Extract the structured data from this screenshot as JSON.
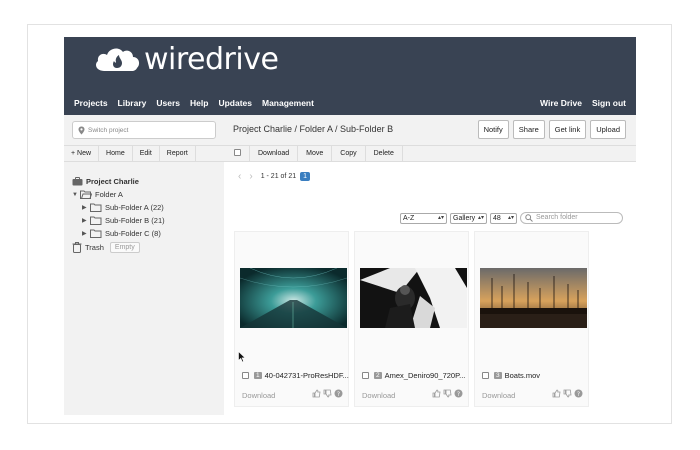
{
  "brand": {
    "name": "wiredrive"
  },
  "nav": {
    "items": [
      "Projects",
      "Library",
      "Users",
      "Help",
      "Updates",
      "Management"
    ],
    "right": [
      "Wire Drive",
      "Sign out"
    ]
  },
  "sidebar": {
    "switch_placeholder": "Switch project",
    "tools": [
      "+ New",
      "Home",
      "Edit",
      "Report"
    ],
    "tree": {
      "project": "Project Charlie",
      "folder": "Folder A",
      "subfolders": [
        "Sub-Folder A (22)",
        "Sub-Folder B (21)",
        "Sub-Folder C (8)"
      ],
      "trash": "Trash",
      "empty": "Empty"
    }
  },
  "main": {
    "breadcrumb": "Project Charlie / Folder A / Sub-Folder B",
    "actions": [
      "Notify",
      "Share",
      "Get link",
      "Upload"
    ],
    "toolbar": [
      "Download",
      "Move",
      "Copy",
      "Delete"
    ],
    "pager": {
      "range": "1 - 21 of 21",
      "page": "1"
    },
    "sort": "A-Z",
    "view": "Gallery",
    "per_page": "48",
    "search_placeholder": "Search folder",
    "cards": [
      {
        "num": "1",
        "name": "40-042731-ProResHDF...",
        "download": "Download",
        "thumb": "tunnel"
      },
      {
        "num": "2",
        "name": "Amex_Deniro90_720P...",
        "download": "Download",
        "thumb": "dancer"
      },
      {
        "num": "3",
        "name": "Boats.mov",
        "download": "Download",
        "thumb": "boats"
      }
    ]
  },
  "colors": {
    "header": "#394353",
    "accent": "#3a7ec0",
    "sidebar": "#f2f2f2"
  }
}
